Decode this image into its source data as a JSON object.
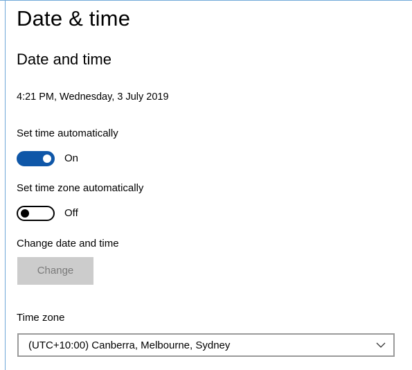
{
  "header": {
    "title": "Date & time"
  },
  "section": {
    "title": "Date and time",
    "current_datetime": "4:21 PM, Wednesday, 3 July 2019"
  },
  "auto_time": {
    "label": "Set time automatically",
    "state": "On",
    "enabled": true
  },
  "auto_timezone": {
    "label": "Set time zone automatically",
    "state": "Off",
    "enabled": false
  },
  "change_datetime": {
    "label": "Change date and time",
    "button_label": "Change",
    "button_disabled": true
  },
  "timezone": {
    "label": "Time zone",
    "selected": "(UTC+10:00) Canberra, Melbourne, Sydney"
  },
  "icons": {
    "dropdown": "chevron-down-icon"
  },
  "colors": {
    "toggle_on": "#0f57a8",
    "toggle_off_border": "#000000",
    "button_disabled_bg": "#cccccc",
    "button_disabled_text": "#7a7a7a",
    "frame_border": "#6fa8d8"
  }
}
